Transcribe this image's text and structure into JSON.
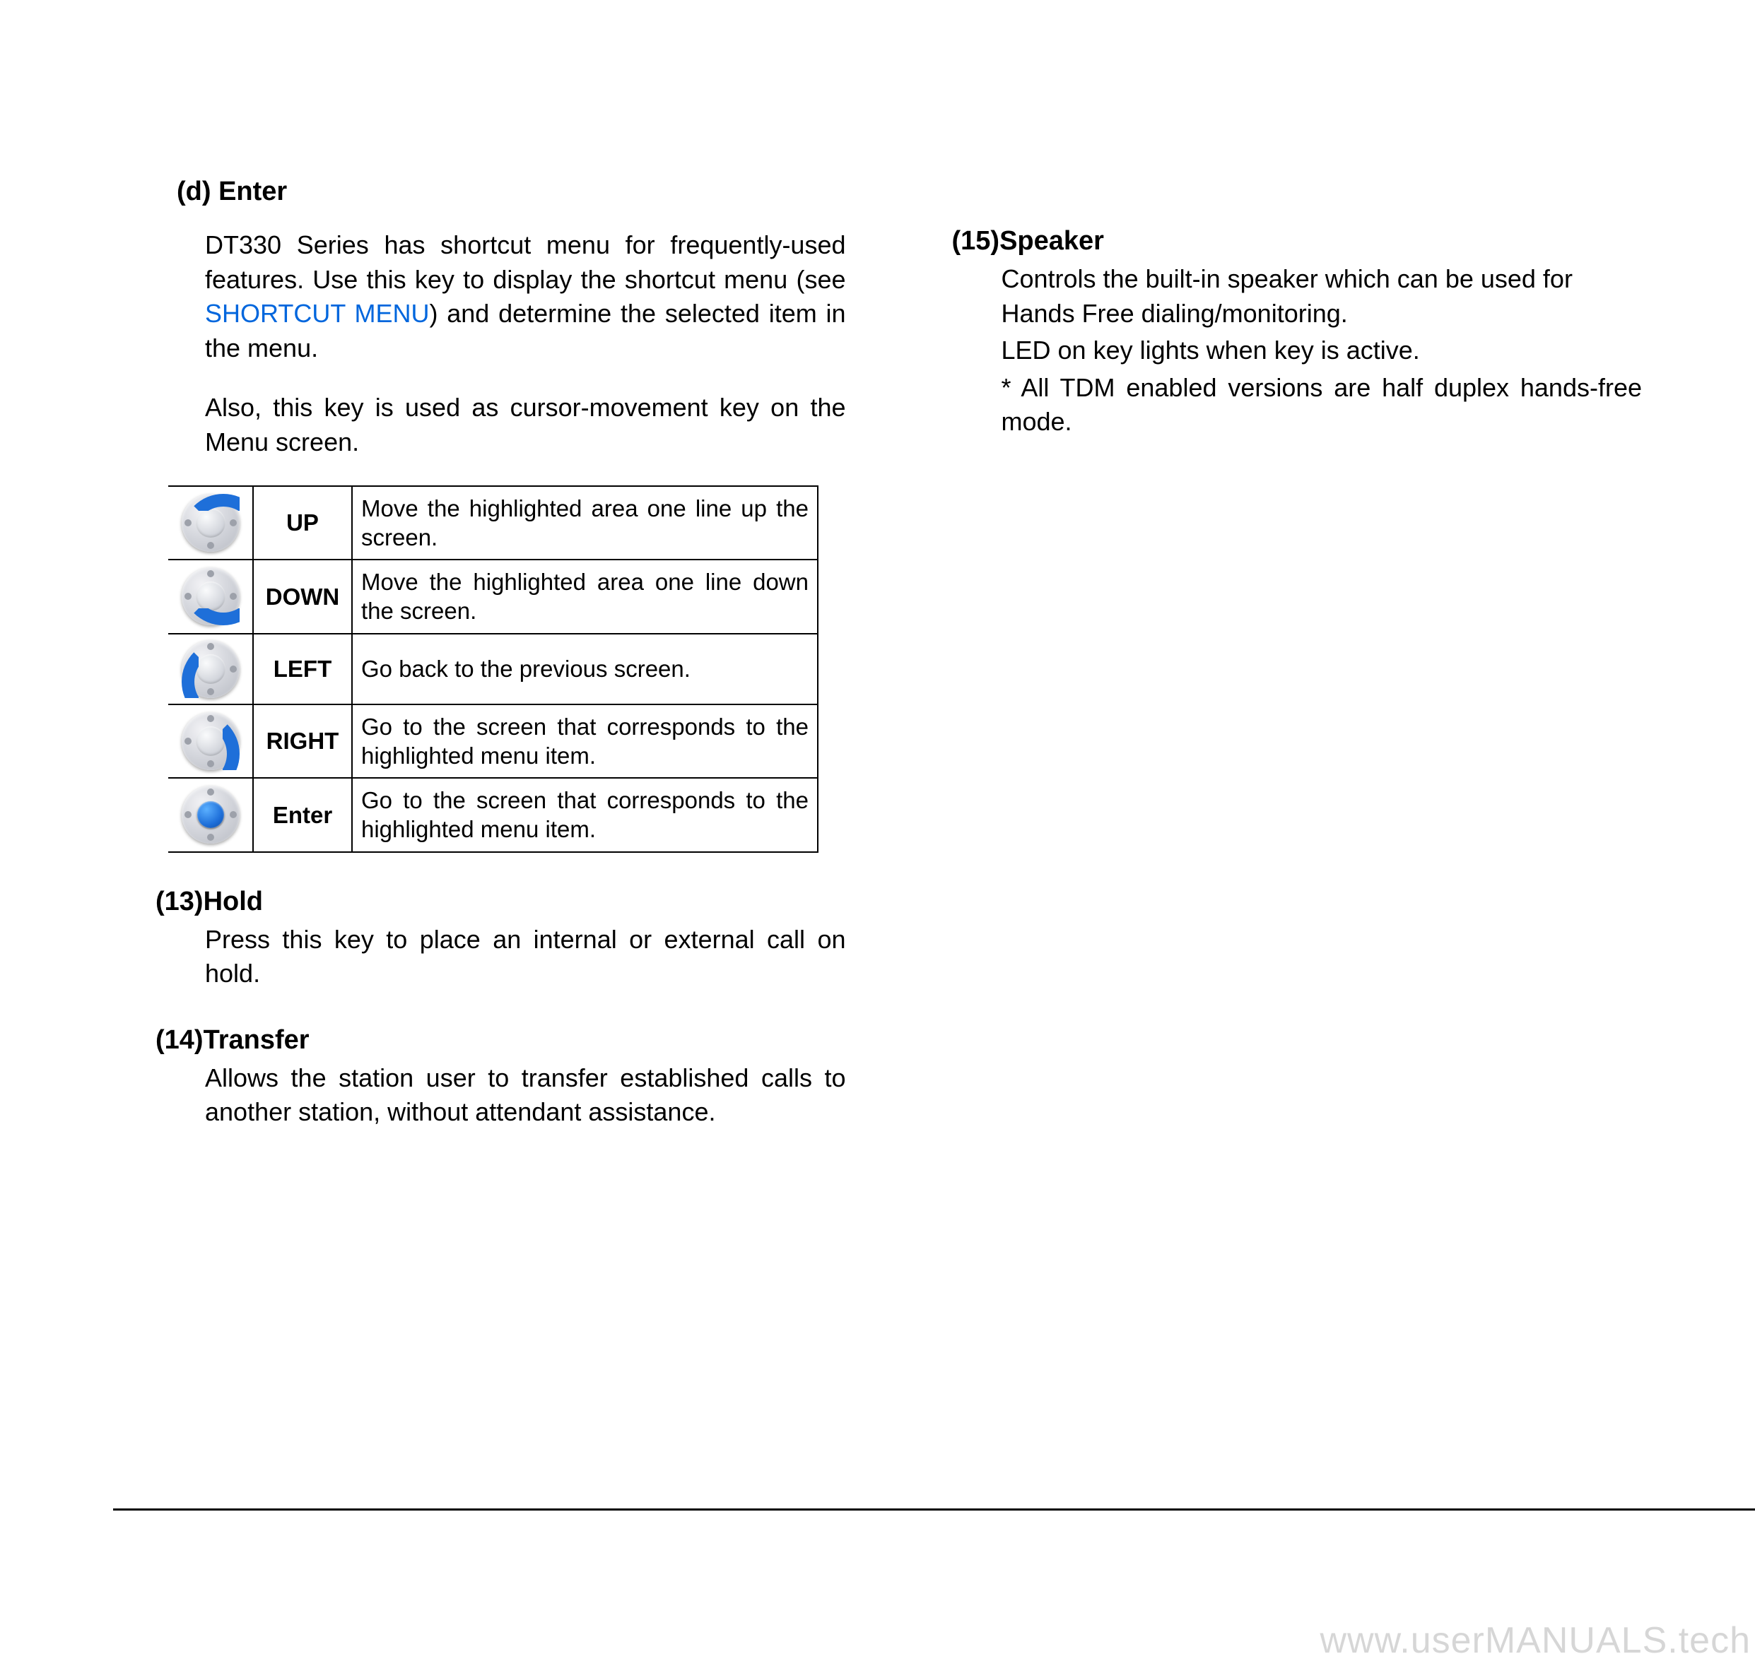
{
  "left": {
    "enter": {
      "heading": "(d) Enter",
      "p1a": "DT330 Series has shortcut menu for frequently-used features. Use this key to display the shortcut menu (see ",
      "p1link": "SHORTCUT MENU",
      "p1b": ") and determine the selected item in the menu.",
      "p2": "Also, this key is used as cursor-movement key on the Menu screen."
    },
    "table": [
      {
        "dir": "up",
        "key": "UP",
        "desc": "Move the highlighted area one line up the screen."
      },
      {
        "dir": "down",
        "key": "DOWN",
        "desc": "Move the highlighted area one line down the screen."
      },
      {
        "dir": "left",
        "key": "LEFT",
        "desc": "Go back to the previous screen."
      },
      {
        "dir": "right",
        "key": "RIGHT",
        "desc": "Go to the screen that corresponds to the highlighted menu item."
      },
      {
        "dir": "enter",
        "key": "Enter",
        "desc": "Go to the screen that corresponds to the highlighted menu item."
      }
    ],
    "hold": {
      "heading": "(13)Hold",
      "p": "Press this key to place an internal or external call on hold."
    },
    "transfer": {
      "heading": "(14)Transfer",
      "p": "Allows the station user to transfer established calls to another station, without attendant assistance."
    }
  },
  "right": {
    "speaker": {
      "heading": "(15)Speaker",
      "p1": "Controls the built-in speaker which can be used for Hands Free dialing/monitoring.",
      "p2": "LED on key lights when key is active.",
      "p3": "* All TDM enabled versions are half duplex hands-free mode."
    }
  },
  "watermark": "www.userMANUALS.tech"
}
